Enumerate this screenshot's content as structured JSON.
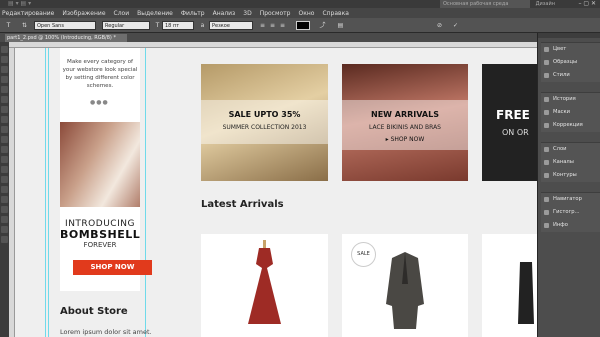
{
  "topbar": {
    "right_field": "Основная рабочая среда",
    "right_link": "Дизайн",
    "window_controls": "– ▢ ✕"
  },
  "menu": [
    "Редактирование",
    "Изображение",
    "Слои",
    "Выделение",
    "Фильтр",
    "Анализ",
    "3D",
    "Просмотр",
    "Окно",
    "Справка"
  ],
  "options": {
    "font_family": "Open Sans",
    "font_style": "Regular",
    "font_size": "18 пт",
    "antialias": "Резкое"
  },
  "document_tab": "part1_2.psd @ 100% (Introducing, RGB/8) *",
  "canvas": {
    "left_column": {
      "intro_text": "Make every category of your webstore look special by setting different color schemes.",
      "dots": "●●●",
      "introducing": "INTRODUCING",
      "bombshell": "BOMBSHELL",
      "forever": "FOREVER",
      "shop_now": "SHOP NOW",
      "about_heading": "About Store",
      "lorem": "Lorem ipsum dolor sit amet."
    },
    "banners": [
      {
        "title": "SALE UPTO 35%",
        "subtitle": "SUMMER COLLECTION 2013",
        "shop": ""
      },
      {
        "title": "NEW ARRIVALS",
        "subtitle": "LACE BIKINIS AND BRAS",
        "shop": "▸ SHOP NOW"
      },
      {
        "title": "FREE",
        "subtitle": "ON OR"
      }
    ],
    "latest_heading": "Latest Arrivals",
    "products": [
      {
        "badge": ""
      },
      {
        "badge": "SALE"
      },
      {
        "badge": ""
      }
    ]
  },
  "panels": {
    "group1": [
      "Цвет",
      "Образцы",
      "Стили"
    ],
    "group2": [
      "История",
      "Маски",
      "Коррекция"
    ],
    "group3": [
      "Слои",
      "Каналы",
      "Контуры"
    ],
    "group4": [
      "Навигатор",
      "Гистогр...",
      "Инфо"
    ]
  },
  "colors": {
    "accent_red": "#e13a1c",
    "guide": "#4fd5e8",
    "ps_dark": "#535353"
  }
}
